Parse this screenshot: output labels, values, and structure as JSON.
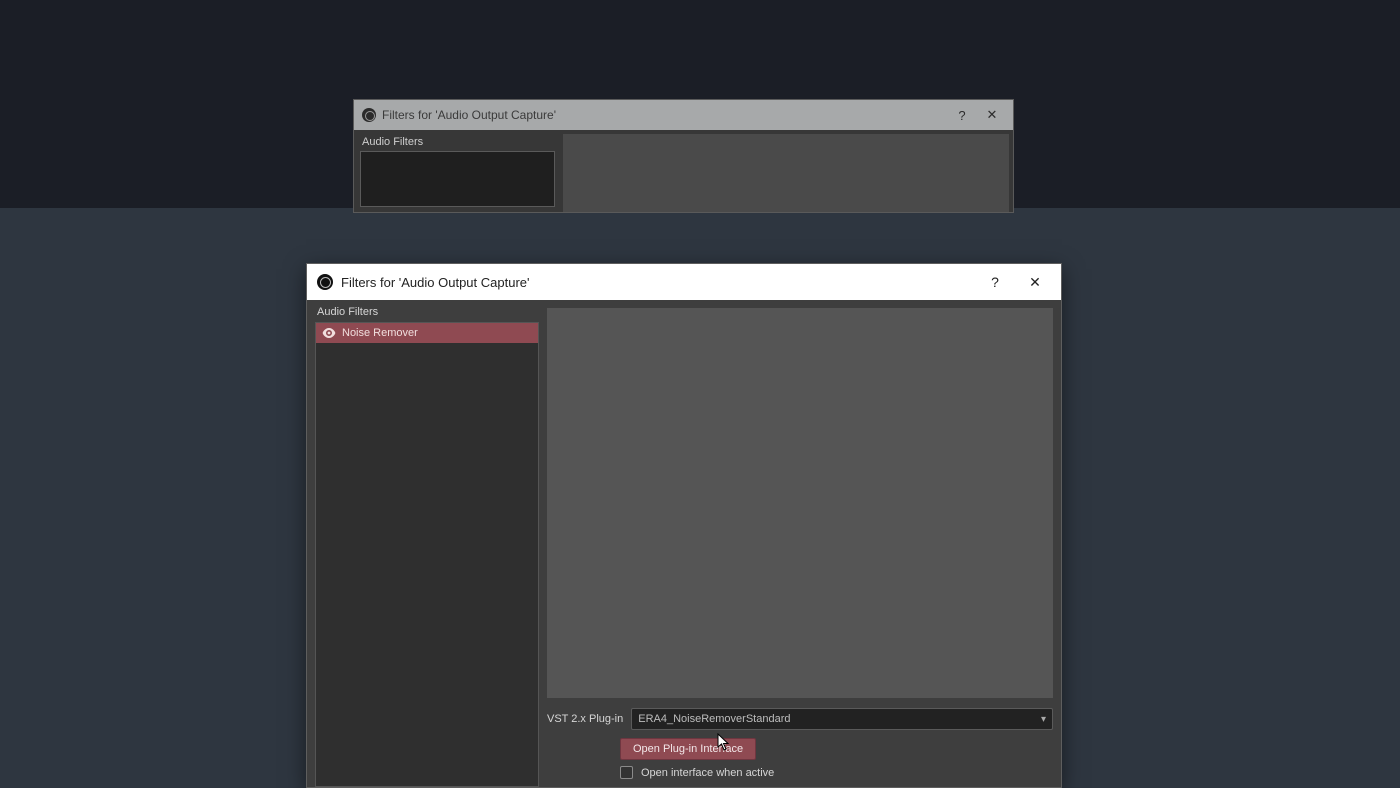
{
  "back_dialog": {
    "title": "Filters for 'Audio Output Capture'",
    "section_label": "Audio Filters",
    "help_symbol": "?",
    "close_symbol": "✕"
  },
  "front_dialog": {
    "title": "Filters for 'Audio Output Capture'",
    "section_label": "Audio Filters",
    "help_symbol": "?",
    "close_symbol": "✕",
    "filters": [
      {
        "label": "Noise Remover",
        "visible": true,
        "selected": true
      }
    ],
    "controls": {
      "vst_label": "VST 2.x Plug-in",
      "vst_selected": "ERA4_NoiseRemoverStandard",
      "open_plugin_button": "Open Plug-in Interface",
      "open_when_active_label": "Open interface when active",
      "open_when_active_checked": false
    }
  },
  "colors": {
    "accent": "#8f4a52",
    "bg_dark": "#1b1e26",
    "bg_band": "#2e3640"
  }
}
